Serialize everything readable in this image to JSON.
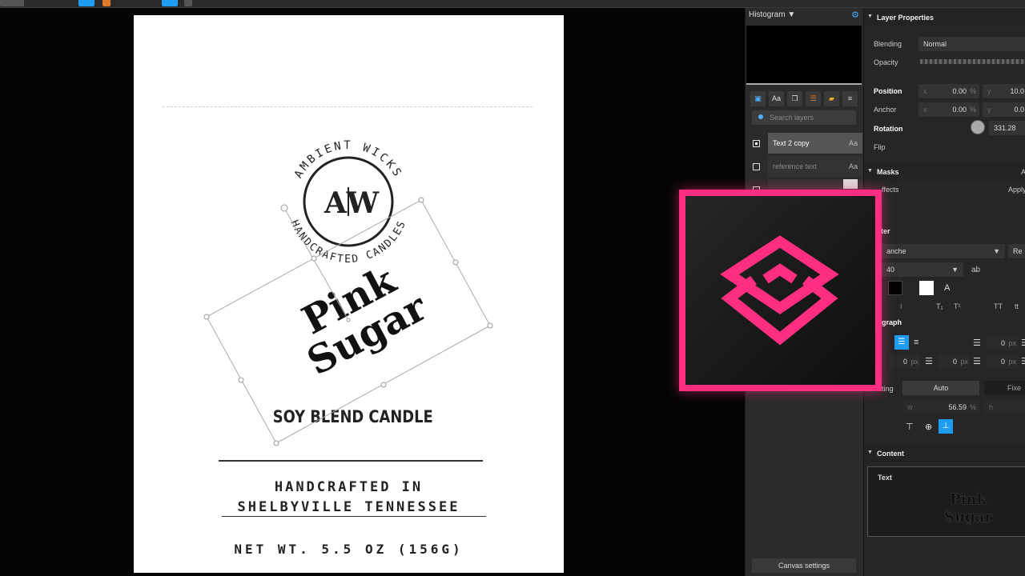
{
  "canvas": {
    "logo": {
      "top_arc": "AMBIENT WICKS",
      "bottom_arc": "HANDCRAFTED CANDLES",
      "monogram_left": "A",
      "monogram_right": "W"
    },
    "title_line1": "Pink",
    "title_line2": "Sugar",
    "subtitle": "SOY BLEND CANDLE",
    "origin_line1": "HANDCRAFTED IN",
    "origin_line2": "SHELBYVILLE TENNESSEE",
    "net_weight": "NET WT. 5.5 OZ (156G)"
  },
  "histogram": {
    "title": "Histogram ▼",
    "gear": "⚙"
  },
  "layers": {
    "search_placeholder": "Search layers",
    "items": [
      {
        "name": "Text 2 copy",
        "type": "Aa"
      },
      {
        "name": "reference text",
        "type": "Aa"
      }
    ],
    "canvas_settings": "Canvas settings"
  },
  "properties": {
    "layer_properties": {
      "header": "Layer Properties",
      "blending_label": "Blending",
      "blending_value": "Normal",
      "opacity_label": "Opacity",
      "position_label": "Position",
      "anchor_label": "Anchor",
      "rotation_label": "Rotation",
      "rotation_value": "331.28",
      "flip_label": "Flip",
      "x_axis": "x",
      "y_axis": "y",
      "pct": "%",
      "position_x": "0.00",
      "position_y": "10.0",
      "anchor_x": "0.00",
      "anchor_y": "0.0"
    },
    "masks": {
      "header": "Masks",
      "effects_label": "ffects",
      "apply": "Apply",
      "a": "A"
    },
    "character": {
      "header": "cter",
      "font": "anche",
      "font_extra": "Re",
      "size": "40",
      "kerning": "a̶b",
      "sub": "T₁",
      "sup": "T¹",
      "caps": "TT",
      "smallcaps": "tt"
    },
    "paragraph": {
      "header": "graph",
      "indent_val_1": "0",
      "indent_val_2": "0",
      "indent_val_3": "0",
      "indent_val_4": "0",
      "px": "px",
      "sizing_label": "ting",
      "auto": "Auto",
      "fixed": "Fixe",
      "w_label": "w",
      "w_value": "56.59",
      "h_label": "h"
    },
    "content": {
      "header": "Content",
      "text_label": "Text",
      "preview_line1": "Pink",
      "preview_line2": "Sugar"
    }
  },
  "colors": {
    "accent": "#1e9cf0",
    "brand_pink": "#ff2e80"
  }
}
